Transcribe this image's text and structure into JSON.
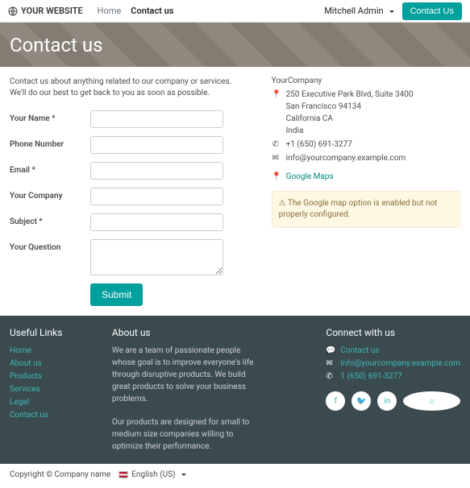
{
  "nav": {
    "brand": "YOUR WEBSITE",
    "links": [
      {
        "label": "Home",
        "active": false
      },
      {
        "label": "Contact us",
        "active": true
      }
    ],
    "user": "Mitchell Admin",
    "contact_btn": "Contact Us"
  },
  "hero": {
    "title": "Contact us"
  },
  "intro": {
    "l1": "Contact us about anything related to our company or services.",
    "l2": "We'll do our best to get back to you as soon as possible."
  },
  "form": {
    "name": "Your Name *",
    "phone": "Phone Number",
    "email": "Email *",
    "company": "Your Company",
    "subject": "Subject *",
    "question": "Your Question",
    "submit": "Submit"
  },
  "company": {
    "name": "YourCompany",
    "addr1": "250 Executive Park Blvd, Suite 3400",
    "addr2": "San Francisco 94134",
    "addr3": "California CA",
    "addr4": "India",
    "phone": "+1 (650) 691-3277",
    "email": "info@yourcompany.example.com",
    "maps": "Google Maps"
  },
  "warning": "The Google map option is enabled but not properly configured.",
  "footer": {
    "useful_h": "Useful Links",
    "useful": [
      "Home",
      "About us",
      "Products",
      "Services",
      "Legal",
      "Contact us"
    ],
    "about_h": "About us",
    "about_p1": "We are a team of passionate people whose goal is to improve everyone's life through disruptive products. We build great products to solve your business problems.",
    "about_p2": "Our products are designed for small to medium size companies willing to optimize their performance.",
    "connect_h": "Connect with us",
    "connect_contact": "Contact us",
    "connect_email": "info@yourcompany.example.com",
    "connect_phone": "1 (650) 691-3277"
  },
  "copyright": "Copyright © Company name",
  "lang": "English (US)"
}
